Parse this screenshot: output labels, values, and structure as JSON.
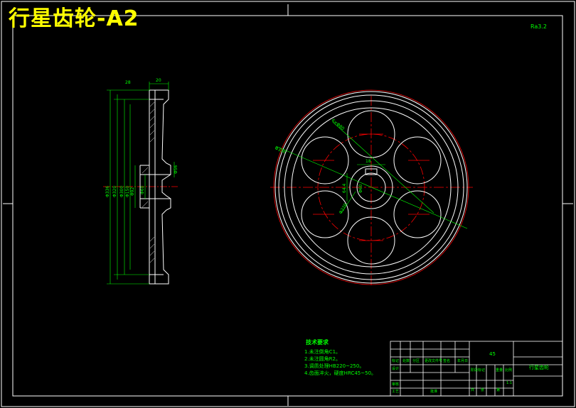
{
  "title": "行星齿轮-A2",
  "surface_finish": "Ra3.2",
  "tech_requirements": {
    "heading": "技术要求",
    "items": [
      "1.未注倒角C1。",
      "2.未注圆角R2。",
      "3.调质处理HB220~250。",
      "4.齿面淬火，硬度HRC45~50。"
    ]
  },
  "title_block": {
    "material": "45",
    "part_name": "行星齿轮",
    "scale": "1:1",
    "labels": [
      "设计",
      "审核",
      "工艺",
      "批准",
      "标记",
      "处数",
      "分区",
      "更改文件号",
      "签名",
      "年月日",
      "阶段标记",
      "重量",
      "比例",
      "共",
      "张",
      "第"
    ]
  },
  "dimensions": {
    "side_top": "28",
    "side_width": "20",
    "d1": "Φ336",
    "d2": "Φ320",
    "d3": "Φ300",
    "d4": "Φ150",
    "d5": "Φ92",
    "d6": "Φ60",
    "d_right": "Φ56",
    "front_holes": "6×Φ80",
    "front_outer": "Φ336",
    "front_bore": "Φ60",
    "front_pcd": "Φ220",
    "front_key": "18",
    "front_h": "64.4"
  },
  "colors": {
    "background": "#000000",
    "outline": "#ffffff",
    "dimension": "#00ff00",
    "centerline": "#ff0000",
    "title": "#ffff00"
  }
}
